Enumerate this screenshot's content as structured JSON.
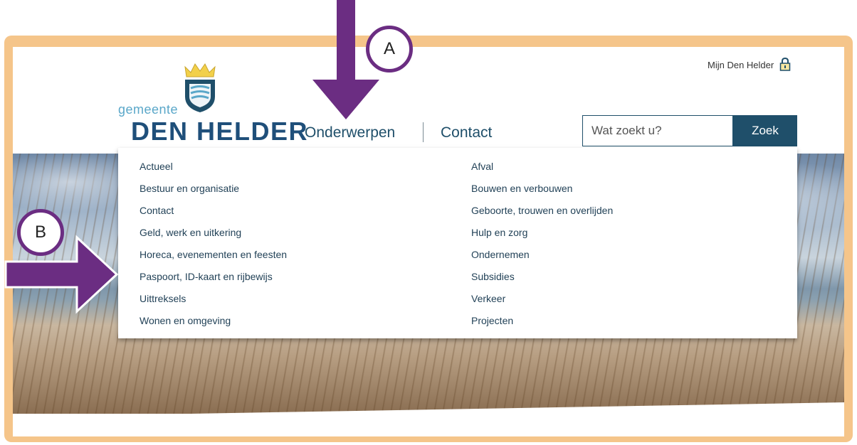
{
  "header": {
    "logo_small": "gemeente",
    "logo_big": "DEN HELDER",
    "mijn_link": "Mijn Den Helder"
  },
  "nav": {
    "topics_label": "Onderwerpen",
    "contact_label": "Contact"
  },
  "search": {
    "placeholder": "Wat zoekt u?",
    "button_label": "Zoek"
  },
  "menu": {
    "left": [
      "Actueel",
      "Bestuur en organisatie",
      "Contact",
      "Geld, werk en uitkering",
      "Horeca, evenementen en feesten",
      "Paspoort, ID-kaart en rijbewijs",
      "Uittreksels",
      "Wonen en omgeving"
    ],
    "right": [
      "Afval",
      "Bouwen en verbouwen",
      "Geboorte, trouwen en overlijden",
      "Hulp en zorg",
      "Ondernemen",
      "Subsidies",
      "Verkeer",
      "Projecten"
    ]
  },
  "annotations": {
    "a_label": "A",
    "b_label": "B"
  },
  "colors": {
    "frame": "#f5c58a",
    "brand": "#1f4f6a",
    "arrow": "#6b2d82"
  }
}
